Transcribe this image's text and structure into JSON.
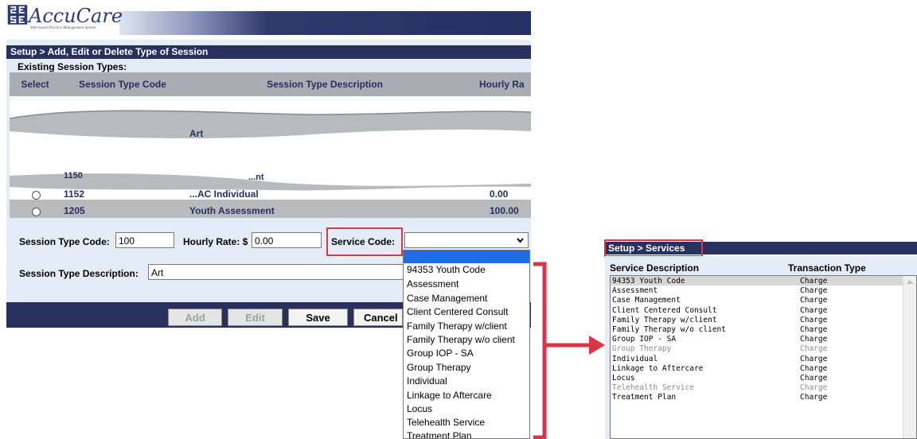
{
  "app": {
    "name": "AccuCare",
    "tagline": "Web-based Practice Management System"
  },
  "page": {
    "title": "Setup > Add, Edit or Delete Type of Session",
    "section_label": "Existing Session Types:"
  },
  "grid": {
    "headers": [
      "Select",
      "Session Type Code",
      "Session Type Description",
      "Hourly Ra"
    ],
    "highlight_row": {
      "description": "Art"
    },
    "partial_row": {
      "code": "1150",
      "description": "...nt"
    },
    "rows": [
      {
        "code": "1152",
        "description": "...AC Individual",
        "rate": "0.00"
      },
      {
        "code": "1205",
        "description": "Youth Assessment",
        "rate": "100.00"
      }
    ]
  },
  "form": {
    "code_label": "Session Type Code:",
    "code_value": "100",
    "rate_label": "Hourly Rate: $",
    "rate_value": "0.00",
    "service_label": "Service Code:",
    "service_value": "",
    "desc_label": "Session Type Description:",
    "desc_value": "Art"
  },
  "buttons": {
    "add": "Add",
    "edit": "Edit",
    "save": "Save",
    "cancel": "Cancel"
  },
  "dropdown": {
    "options": [
      "94353 Youth Code",
      "Assessment",
      "Case Management",
      "Client Centered Consult",
      "Family Therapy w/client",
      "Family Therapy w/o client",
      "Group IOP - SA",
      "Group Therapy",
      "Individual",
      "Linkage to Aftercare",
      "Locus",
      "Telehealth Service",
      "Treatment Plan"
    ]
  },
  "services": {
    "title": "Setup > Services",
    "col_desc": "Service Description",
    "col_type": "Transaction Type",
    "rows": [
      {
        "desc": "94353 Youth Code",
        "type": "Charge",
        "dim": false
      },
      {
        "desc": "Assessment",
        "type": "Charge",
        "dim": false
      },
      {
        "desc": "Case Management",
        "type": "Charge",
        "dim": false
      },
      {
        "desc": "Client Centered Consult",
        "type": "Charge",
        "dim": false
      },
      {
        "desc": "Family Therapy w/client",
        "type": "Charge",
        "dim": false
      },
      {
        "desc": "Family Therapy w/o client",
        "type": "Charge",
        "dim": false
      },
      {
        "desc": "Group IOP - SA",
        "type": "Charge",
        "dim": false
      },
      {
        "desc": "Group Therapy",
        "type": "Charge",
        "dim": true
      },
      {
        "desc": "Individual",
        "type": "Charge",
        "dim": false
      },
      {
        "desc": "Linkage to Aftercare",
        "type": "Charge",
        "dim": false
      },
      {
        "desc": "Locus",
        "type": "Charge",
        "dim": false
      },
      {
        "desc": "Telehealth Service",
        "type": "Charge",
        "dim": true
      },
      {
        "desc": "Treatment Plan",
        "type": "Charge",
        "dim": false
      }
    ]
  },
  "colors": {
    "navy": "#28305e",
    "panel": "#e4ecf8",
    "highlight_red": "#d9364a",
    "select_blue": "#1e6ce6"
  }
}
